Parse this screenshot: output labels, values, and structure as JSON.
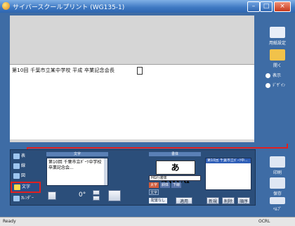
{
  "window": {
    "title": "サイバースクールプリント (WG135-1)",
    "min_label": "–",
    "max_label": "□",
    "close_label": "×"
  },
  "document": {
    "line_text": "第10回 千葉市立某中学校 平成 卒業記念会長"
  },
  "right_sidebar": {
    "page_setup": "用紙設定",
    "open": "開く",
    "small1": "表示",
    "small2": "ﾃﾞｻﾞｲﾝ",
    "print": "印刷",
    "save": "保存",
    "help": "ﾍﾙﾌﾟ"
  },
  "left_list": {
    "items": [
      "表",
      "線",
      "図",
      "文字",
      "ｶﾚﾝﾀﾞｰ"
    ],
    "active_label": "文字"
  },
  "text_panel": {
    "header": "文字",
    "content": "第10回 千葉市立ﾎﾟｰﾂ中学校 卒業記念会...",
    "rotate_value": "0°"
  },
  "font_panel": {
    "header": "書体",
    "preview": "あABCd",
    "font_name": "HG行書体",
    "bold": "太字",
    "italic": "斜体",
    "underline": "下線",
    "size_label": "文字",
    "align": "配置なし",
    "apply": "適用"
  },
  "list_panel": {
    "row": "第10回 千葉市立ﾎﾟｰﾂ中..."
  },
  "bottom_buttons": {
    "new": "新規",
    "delete": "削除",
    "reorder": "順序"
  },
  "status": {
    "left": "Ready",
    "right": "OCRL"
  }
}
